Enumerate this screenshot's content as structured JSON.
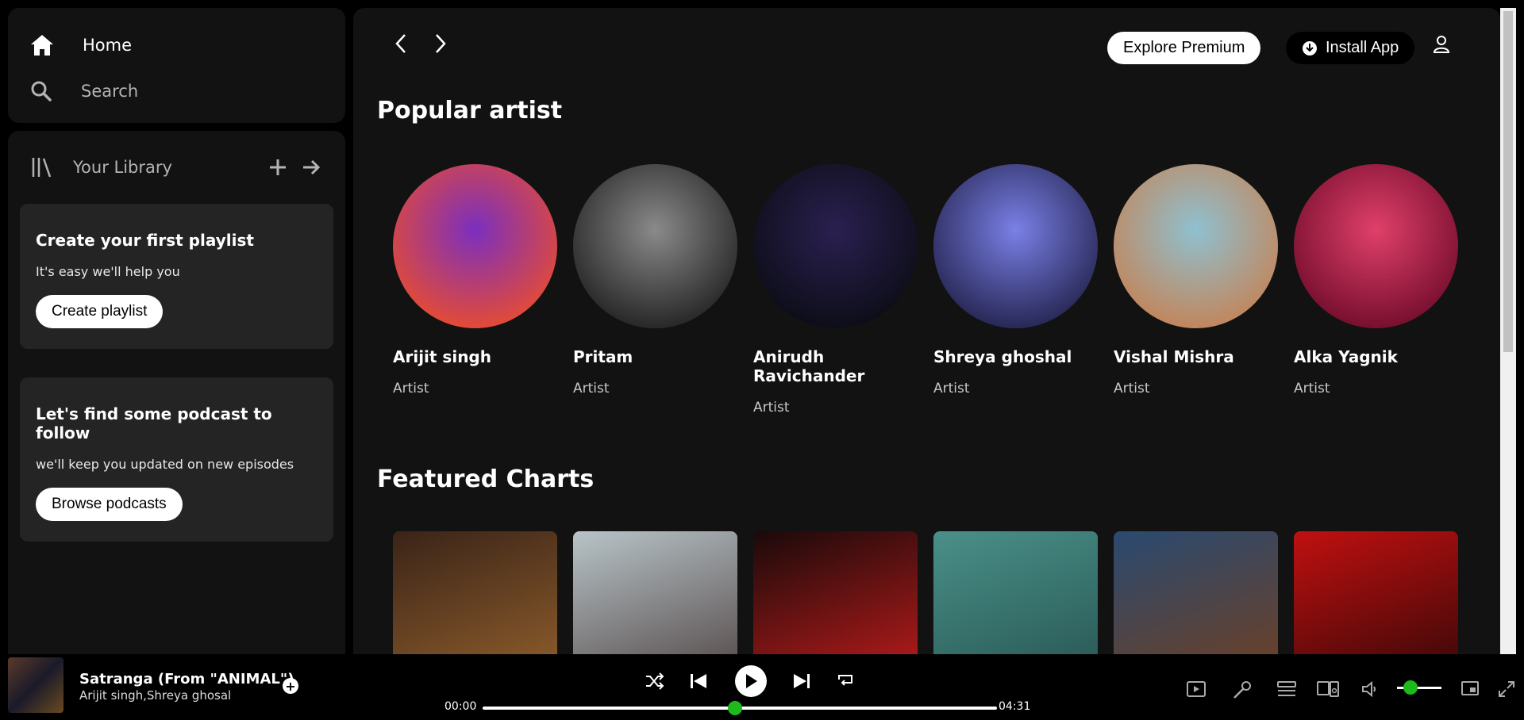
{
  "sidebar": {
    "home_label": "Home",
    "search_label": "Search",
    "library_label": "Your Library",
    "playlist_card": {
      "title": "Create your first playlist",
      "subtitle": "It's easy we'll help you",
      "button": "Create playlist"
    },
    "podcast_card": {
      "title": "Let's find some podcast to follow",
      "subtitle": "we'll keep you updated on new episodes",
      "button": "Browse podcasts"
    }
  },
  "header": {
    "explore_premium": "Explore Premium",
    "install_app": "Install App"
  },
  "sections": {
    "popular_artist": "Popular artist",
    "featured_charts": "Featured Charts"
  },
  "artists": [
    {
      "name": "Arijit singh",
      "role": "Artist",
      "colors": [
        "#7b2fbf",
        "#e04a3a"
      ]
    },
    {
      "name": "Pritam",
      "role": "Artist",
      "colors": [
        "#8a8a8a",
        "#2a2a2a"
      ]
    },
    {
      "name": "Anirudh Ravichander",
      "role": "Artist",
      "colors": [
        "#2a2050",
        "#0e0e1a"
      ]
    },
    {
      "name": "Shreya ghoshal",
      "role": "Artist",
      "colors": [
        "#7a80e6",
        "#2a2a5a"
      ]
    },
    {
      "name": "Vishal Mishra",
      "role": "Artist",
      "colors": [
        "#8fc0d0",
        "#c08860"
      ]
    },
    {
      "name": "Alka Yagnik",
      "role": "Artist",
      "colors": [
        "#e0406a",
        "#7a1030"
      ]
    }
  ],
  "charts": [
    {
      "colors": [
        "#3a2418",
        "#8a5a2a"
      ]
    },
    {
      "colors": [
        "#b8c4c8",
        "#5a5050"
      ]
    },
    {
      "colors": [
        "#1a0a0a",
        "#b01a1a"
      ]
    },
    {
      "colors": [
        "#4a9088",
        "#2a5a58"
      ]
    },
    {
      "colors": [
        "#2a4a70",
        "#6a4028"
      ]
    },
    {
      "colors": [
        "#c01010",
        "#400808"
      ]
    }
  ],
  "player": {
    "track_title": "Satranga (From \"ANIMAL\")",
    "track_artist": "Arijit singh,Shreya ghosal",
    "time_current": "00:00",
    "time_total": "04:31",
    "progress_fraction": 0.49,
    "volume_fraction": 0.3,
    "accent": "#1db91d"
  }
}
